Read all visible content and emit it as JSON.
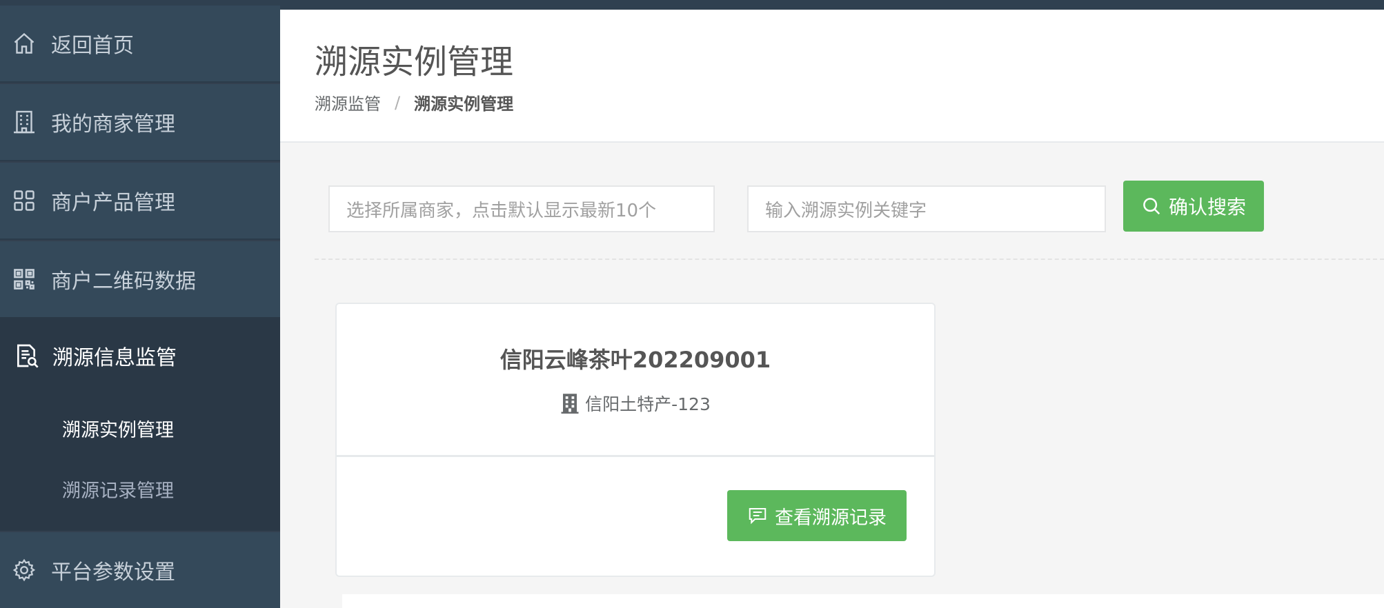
{
  "sidebar": {
    "items": [
      {
        "label": "返回首页",
        "icon": "home-icon"
      },
      {
        "label": "我的商家管理",
        "icon": "building-icon"
      },
      {
        "label": "商户产品管理",
        "icon": "grid-icon"
      },
      {
        "label": "商户二维码数据",
        "icon": "qrcode-icon"
      }
    ],
    "group": {
      "label": "溯源信息监管",
      "icon": "document-search-icon",
      "children": [
        "溯源实例管理",
        "溯源记录管理"
      ]
    },
    "settings": {
      "label": "平台参数设置",
      "icon": "gear-icon"
    }
  },
  "header": {
    "title": "溯源实例管理",
    "breadcrumb": [
      "溯源监管",
      "溯源实例管理"
    ],
    "separator": "/"
  },
  "search": {
    "merchant_placeholder": "选择所属商家，点击默认显示最新10个",
    "keyword_placeholder": "输入溯源实例关键字",
    "button_label": "确认搜索"
  },
  "card": {
    "title": "信阳云峰茶叶202209001",
    "merchant": "信阳土特产-123",
    "button_label": "查看溯源记录"
  },
  "colors": {
    "sidebar": "#34495a",
    "accent_green": "#5cb85c"
  }
}
